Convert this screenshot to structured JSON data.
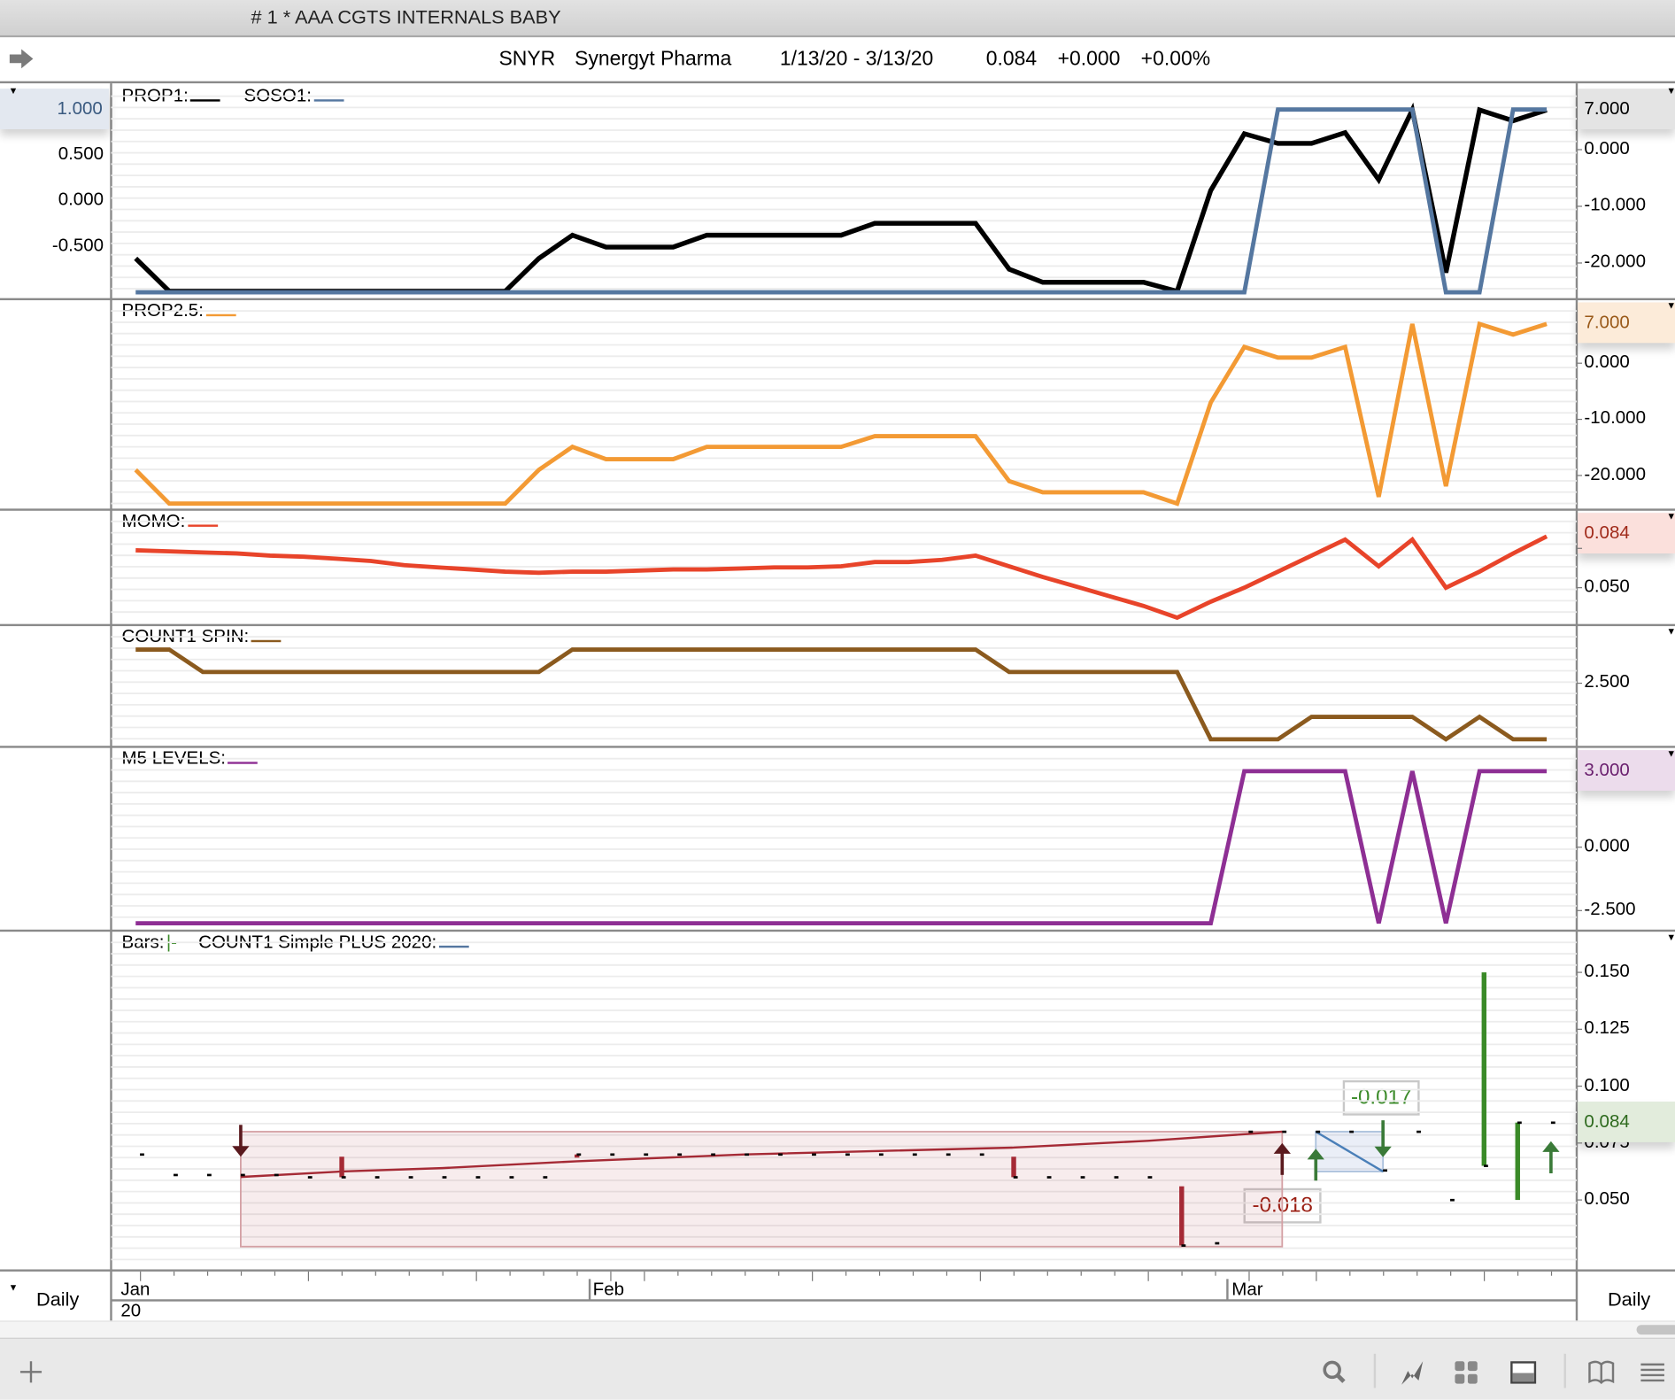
{
  "window": {
    "title": "# 1 * AAA  CGTS INTERNALS BABY"
  },
  "header": {
    "symbol": "SNYR",
    "company": "Synergyt Pharma",
    "date_range": "1/13/20 - 3/13/20",
    "last": "0.084",
    "change": "+0.000",
    "change_pct": "+0.00%"
  },
  "timeframe": {
    "left": "Daily",
    "right": "Daily"
  },
  "date_axis": {
    "months": [
      "Jan",
      "Feb",
      "Mar"
    ],
    "year": "20",
    "month_start_index": [
      0,
      14,
      33
    ]
  },
  "toolbar": {
    "icons": [
      "add-icon",
      "search-icon",
      "chart-style-icon",
      "layout-grid-icon",
      "panel-icon",
      "book-icon",
      "menu-icon"
    ]
  },
  "colors": {
    "prop1": "#000000",
    "soso1": "#5577a0",
    "prop25": "#f39a34",
    "momo": "#e8442a",
    "count1spin": "#8b5a1e",
    "m5": "#8e2f94",
    "bar_down": "#a52a35",
    "bar_up": "#3a8a28"
  },
  "chart_data": [
    {
      "type": "line",
      "title_parts": [
        {
          "label": "PROP1:",
          "color": "#000000"
        },
        {
          "label": "SOSO1:",
          "color": "#5577a0"
        }
      ],
      "y_range": [
        -26.2,
        11.7
      ],
      "left_range": [
        -1.064,
        1.287
      ],
      "right_ticks": [
        {
          "value": 0,
          "label": "0.000"
        },
        {
          "value": -10,
          "label": "-10.000"
        },
        {
          "value": -20,
          "label": "-20.000"
        }
      ],
      "left_ticks": [
        {
          "value": 0.5,
          "label": "0.500"
        },
        {
          "value": 0,
          "label": "0.000"
        },
        {
          "value": -0.5,
          "label": "-0.500"
        }
      ],
      "highlight": {
        "value": 7,
        "label": "7.000",
        "bg": "#e4e4e4",
        "fg": "#000000"
      },
      "left_highlight": {
        "value": 1,
        "label": "1.000",
        "bg": "#e3e8f0",
        "fg": "#3a5a80"
      },
      "series": [
        {
          "name": "PROP1",
          "color": "#000000",
          "axis": "right",
          "values": [
            -19.2,
            -25,
            -25,
            -25,
            -25,
            -25,
            -25,
            -25,
            -25,
            -25,
            -25,
            -25,
            -19.2,
            -15.1,
            -17.2,
            -17.2,
            -17.2,
            -15.1,
            -15.1,
            -15.1,
            -15.1,
            -15.1,
            -13,
            -13,
            -13,
            -13,
            -21.1,
            -23.4,
            -23.4,
            -23.4,
            -23.4,
            -25,
            -7.2,
            2.8,
            1.1,
            1.1,
            3,
            -5.3,
            7,
            -21.7,
            7,
            5.1,
            7
          ]
        },
        {
          "name": "SOSO1",
          "color": "#5577a0",
          "axis": "left",
          "values": [
            -1,
            -1,
            -1,
            -1,
            -1,
            -1,
            -1,
            -1,
            -1,
            -1,
            -1,
            -1,
            -1,
            -1,
            -1,
            -1,
            -1,
            -1,
            -1,
            -1,
            -1,
            -1,
            -1,
            -1,
            -1,
            -1,
            -1,
            -1,
            -1,
            -1,
            -1,
            -1,
            -1,
            -1,
            1,
            1,
            1,
            1,
            1,
            -1,
            -1,
            1,
            1
          ]
        }
      ]
    },
    {
      "type": "line",
      "title_parts": [
        {
          "label": "PROP2.5:",
          "color": "#f39a34"
        }
      ],
      "y_range": [
        -25.9,
        11.6
      ],
      "right_ticks": [
        {
          "value": 0,
          "label": "0.000"
        },
        {
          "value": -10,
          "label": "-10.000"
        },
        {
          "value": -20,
          "label": "-20.000"
        }
      ],
      "highlight": {
        "value": 7,
        "label": "7.000",
        "bg": "#fcebd9",
        "fg": "#9a5a1a"
      },
      "series": [
        {
          "name": "PROP2.5",
          "color": "#f39a34",
          "axis": "right",
          "values": [
            -19,
            -25,
            -25,
            -25,
            -25,
            -25,
            -25,
            -25,
            -25,
            -25,
            -25,
            -25,
            -19,
            -14.9,
            -17.1,
            -17.1,
            -17.1,
            -14.9,
            -14.9,
            -14.9,
            -14.9,
            -14.9,
            -13,
            -13,
            -13,
            -13,
            -21,
            -23,
            -23,
            -23,
            -23,
            -25,
            -7,
            2.9,
            1,
            1,
            2.9,
            -23.8,
            7,
            -21.9,
            7,
            5.1,
            7
          ]
        }
      ]
    },
    {
      "type": "line",
      "title_parts": [
        {
          "label": "MOMO:",
          "color": "#e8442a"
        }
      ],
      "y_range": [
        0.0269,
        0.1003
      ],
      "right_ticks": [
        {
          "value": 0.075,
          "label": "0.075"
        },
        {
          "value": 0.05,
          "label": "0.050"
        }
      ],
      "highlight": {
        "value": 0.084,
        "label": "0.084",
        "bg": "#fbe0dc",
        "fg": "#a02a1a"
      },
      "series": [
        {
          "name": "MOMO",
          "color": "#e8442a",
          "axis": "right",
          "values": [
            0.0738,
            0.0731,
            0.0724,
            0.0718,
            0.0704,
            0.0697,
            0.0684,
            0.067,
            0.0643,
            0.0629,
            0.0616,
            0.0602,
            0.0595,
            0.0602,
            0.0602,
            0.0609,
            0.0616,
            0.0616,
            0.0622,
            0.0629,
            0.0629,
            0.0636,
            0.0663,
            0.0663,
            0.0677,
            0.0704,
            0.0636,
            0.0568,
            0.0507,
            0.0445,
            0.0384,
            0.0309,
            0.0411,
            0.05,
            0.0602,
            0.0704,
            0.0806,
            0.0636,
            0.0806,
            0.05,
            0.0602,
            0.0718,
            0.0826
          ]
        }
      ]
    },
    {
      "type": "line",
      "title_parts": [
        {
          "label": "COUNT1 SPIN:",
          "color": "#8b5a1e"
        }
      ],
      "y_range": [
        -0.29,
        5.14
      ],
      "right_ticks": [
        {
          "value": 2.5,
          "label": "2.500"
        }
      ],
      "series": [
        {
          "name": "COUNT1 SPIN",
          "color": "#8b5a1e",
          "axis": "right",
          "values": [
            4,
            4,
            3,
            3,
            3,
            3,
            3,
            3,
            3,
            3,
            3,
            3,
            3,
            4,
            4,
            4,
            4,
            4,
            4,
            4,
            4,
            4,
            4,
            4,
            4,
            4,
            3,
            3,
            3,
            3,
            3,
            3,
            0,
            0,
            0,
            1,
            1,
            1,
            1,
            0,
            1,
            0,
            0
          ]
        }
      ]
    },
    {
      "type": "line",
      "title_parts": [
        {
          "label": "M5 LEVELS:",
          "color": "#8e2f94"
        }
      ],
      "y_range": [
        -3.25,
        4.0
      ],
      "right_ticks": [
        {
          "value": 0,
          "label": "0.000"
        },
        {
          "value": -2.5,
          "label": "-2.500"
        }
      ],
      "highlight": {
        "value": 3,
        "label": "3.000",
        "bg": "#ecdcec",
        "fg": "#6a1f6e"
      },
      "series": [
        {
          "name": "M5 LEVELS",
          "color": "#8e2f94",
          "axis": "right",
          "values": [
            -3,
            -3,
            -3,
            -3,
            -3,
            -3,
            -3,
            -3,
            -3,
            -3,
            -3,
            -3,
            -3,
            -3,
            -3,
            -3,
            -3,
            -3,
            -3,
            -3,
            -3,
            -3,
            -3,
            -3,
            -3,
            -3,
            -3,
            -3,
            -3,
            -3,
            -3,
            -3,
            -3,
            3,
            3,
            3,
            3,
            -3,
            3,
            -3,
            3,
            3,
            3
          ]
        }
      ]
    },
    {
      "type": "bar",
      "title_parts": [
        {
          "label": "Bars:",
          "color": "#3a8a28",
          "marker": "|-"
        },
        {
          "label": "COUNT1 Simple PLUS 2020:",
          "color": "#5577a0"
        }
      ],
      "y_range": [
        0.0195,
        0.1688
      ],
      "right_ticks": [
        {
          "value": 0.15,
          "label": "0.150"
        },
        {
          "value": 0.125,
          "label": "0.125"
        },
        {
          "value": 0.1,
          "label": "0.100"
        },
        {
          "value": 0.075,
          "label": "0.075"
        },
        {
          "value": 0.05,
          "label": "0.050"
        }
      ],
      "highlight": {
        "value": 0.084,
        "label": "0.084",
        "bg": "#e2ecdc",
        "fg": "#2e6a1e"
      },
      "closes": [
        0.07,
        0.061,
        0.061,
        0.061,
        0.061,
        0.06,
        0.06,
        0.06,
        0.06,
        0.06,
        0.06,
        0.06,
        0.06,
        0.07,
        0.07,
        0.07,
        0.07,
        0.07,
        0.07,
        0.07,
        0.07,
        0.07,
        0.07,
        0.07,
        0.07,
        0.07,
        0.06,
        0.06,
        0.06,
        0.06,
        0.06,
        0.03,
        0.031,
        0.08,
        0.08,
        0.08,
        0.08,
        0.063,
        0.08,
        0.05,
        0.065,
        0.084,
        0.084
      ],
      "range_bars": [
        {
          "index": 6,
          "high": 0.069,
          "low": 0.06,
          "dir": "down"
        },
        {
          "index": 13,
          "high": 0.07,
          "low": 0.069,
          "dir": "down"
        },
        {
          "index": 26,
          "high": 0.069,
          "low": 0.06,
          "dir": "down"
        },
        {
          "index": 31,
          "high": 0.056,
          "low": 0.03,
          "dir": "down"
        },
        {
          "index": 40,
          "high": 0.15,
          "low": 0.065,
          "dir": "up"
        },
        {
          "index": 41,
          "high": 0.084,
          "low": 0.05,
          "dir": "up"
        }
      ],
      "trendline": {
        "index": [
          3,
          6,
          9,
          13,
          18,
          22,
          26,
          30,
          34
        ],
        "values": [
          0.0601,
          0.0625,
          0.064,
          0.067,
          0.07,
          0.0715,
          0.073,
          0.076,
          0.08
        ]
      },
      "zones": [
        {
          "from": 3,
          "to": 34,
          "top": 0.08,
          "bottom": 0.0295,
          "style": "down",
          "label": "-0.018"
        },
        {
          "from": 35,
          "to": 37,
          "top": 0.08,
          "bottom": 0.0625,
          "style": "up",
          "label": "-0.017"
        }
      ],
      "arrows": [
        {
          "index": 3,
          "dir": "down",
          "from": 0.083,
          "to": 0.069,
          "color": "#5a1a1e"
        },
        {
          "index": 34,
          "dir": "up",
          "from": 0.061,
          "to": 0.075,
          "color": "#5a1a1e"
        },
        {
          "index": 35,
          "dir": "up",
          "from": 0.0585,
          "to": 0.0725,
          "color": "#3a7a38"
        },
        {
          "index": 37,
          "dir": "down",
          "from": 0.085,
          "to": 0.0688,
          "color": "#3a7a38"
        },
        {
          "index": 42,
          "dir": "up",
          "from": 0.0617,
          "to": 0.0758,
          "color": "#3a7a38"
        }
      ]
    }
  ]
}
